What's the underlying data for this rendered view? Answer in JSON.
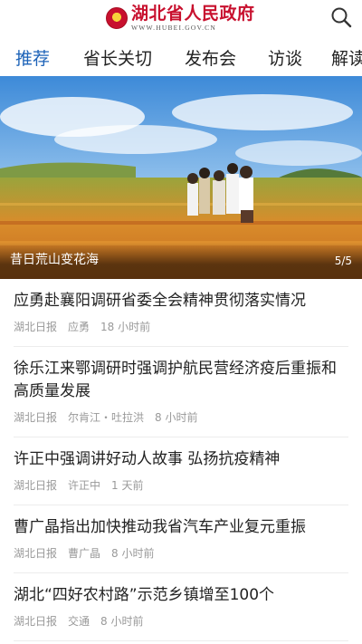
{
  "header": {
    "title": "湖北省人民政府",
    "url": "WWW.HUBEI.GOV.CN"
  },
  "tabs": [
    {
      "label": "推荐",
      "active": true
    },
    {
      "label": "省长关切",
      "active": false
    },
    {
      "label": "发布会",
      "active": false
    },
    {
      "label": "访谈",
      "active": false
    },
    {
      "label": "解读",
      "active": false
    }
  ],
  "banner": {
    "caption": "昔日荒山变花海",
    "pager": "5/5"
  },
  "news": [
    {
      "title": "应勇赴襄阳调研省委全会精神贯彻落实情况",
      "source": "湖北日报",
      "person": "应勇",
      "time": "18 小时前"
    },
    {
      "title": "徐乐江来鄂调研时强调护航民营经济疫后重振和高质量发展",
      "source": "湖北日报",
      "person": "尔肯江・吐拉洪",
      "time": "8 小时前"
    },
    {
      "title": "许正中强调讲好动人故事 弘扬抗疫精神",
      "source": "湖北日报",
      "person": "许正中",
      "time": "1 天前"
    },
    {
      "title": "曹广晶指出加快推动我省汽车产业复元重振",
      "source": "湖北日报",
      "person": "曹广晶",
      "time": "8 小时前"
    },
    {
      "title": "湖北“四好农村路”示范乡镇增至100个",
      "source": "湖北日报",
      "person": "交通",
      "time": "8 小时前"
    }
  ],
  "colors": {
    "brand_red": "#c8102e",
    "active_tab": "#1d63b8"
  }
}
